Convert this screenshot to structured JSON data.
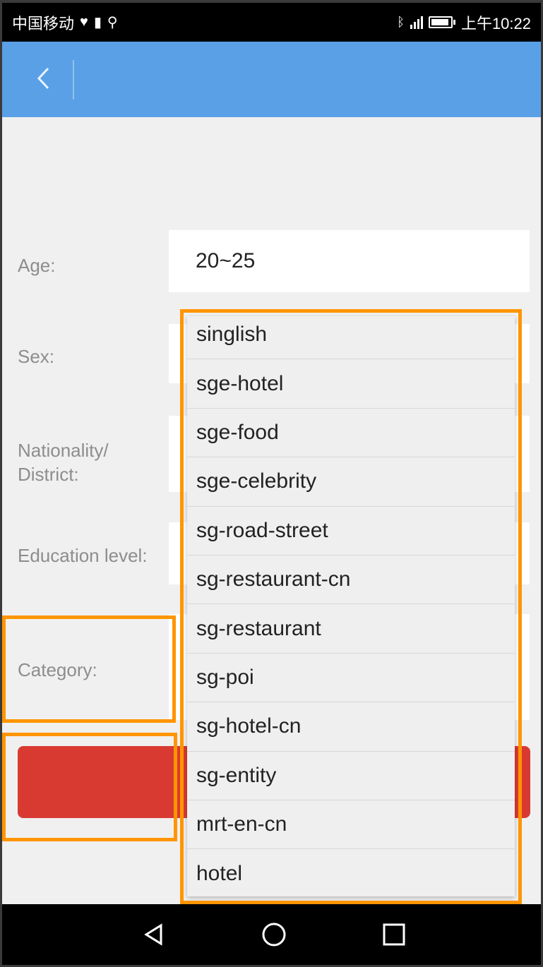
{
  "status_bar": {
    "carrier": "中国移动",
    "time": "上午10:22"
  },
  "header": {
    "back_icon": "chevron-left-icon"
  },
  "form": {
    "fields": [
      {
        "label": "Age:",
        "value": "20~25"
      },
      {
        "label": "Sex:",
        "value": ""
      },
      {
        "label": "Nationality/\nDistrict:",
        "value": ""
      },
      {
        "label": "Education level:",
        "value": ""
      },
      {
        "label": "Category:",
        "value": ""
      }
    ],
    "submit_color": "#d83a32"
  },
  "dropdown": {
    "options": [
      "singlish",
      "sge-hotel",
      "sge-food",
      "sge-celebrity",
      "sg-road-street",
      "sg-restaurant-cn",
      "sg-restaurant",
      "sg-poi",
      "sg-hotel-cn",
      "sg-entity",
      "mrt-en-cn",
      "hotel"
    ]
  },
  "nav_bar": {
    "icons": [
      "back-triangle-icon",
      "home-circle-icon",
      "recents-square-icon"
    ]
  },
  "colors": {
    "header": "#5aa0e6",
    "highlight": "#ff9500"
  }
}
